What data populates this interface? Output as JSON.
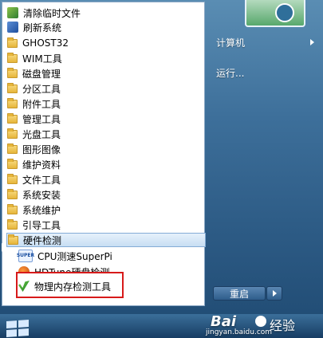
{
  "menu": {
    "items": [
      {
        "label": "清除临时文件",
        "icon": "clean-icon"
      },
      {
        "label": "刷新系统",
        "icon": "refresh-icon"
      },
      {
        "label": "GHOST32",
        "icon": "folder-icon"
      },
      {
        "label": "WIM工具",
        "icon": "folder-icon"
      },
      {
        "label": "磁盘管理",
        "icon": "folder-icon"
      },
      {
        "label": "分区工具",
        "icon": "folder-icon"
      },
      {
        "label": "附件工具",
        "icon": "folder-icon"
      },
      {
        "label": "管理工具",
        "icon": "folder-icon"
      },
      {
        "label": "光盘工具",
        "icon": "folder-icon"
      },
      {
        "label": "图形图像",
        "icon": "folder-icon"
      },
      {
        "label": "维护资料",
        "icon": "folder-icon"
      },
      {
        "label": "文件工具",
        "icon": "folder-icon"
      },
      {
        "label": "系统安装",
        "icon": "folder-icon"
      },
      {
        "label": "系统维护",
        "icon": "folder-icon"
      },
      {
        "label": "引导工具",
        "icon": "folder-icon"
      },
      {
        "label": "硬件检测",
        "icon": "folder-icon"
      }
    ],
    "subitems": [
      {
        "label": "CPU测速SuperPi",
        "icon": "superpi-icon",
        "icon_text": "SUPER"
      },
      {
        "label": "HDTune硬盘检测",
        "icon": "hdtune-icon"
      },
      {
        "label": "物理内存检测工具",
        "icon": "memory-test-icon"
      }
    ]
  },
  "right_panel": {
    "computer_label": "计算机",
    "run_label": "运行...",
    "restart_label": "重启"
  },
  "watermark": {
    "logo": "Bai",
    "text": "经验",
    "url": "jingyan.baidu.com"
  },
  "colors": {
    "highlight_border": "#d71a1a",
    "selected_bg": "#c7def3",
    "taskbar": "#1f4a72"
  }
}
